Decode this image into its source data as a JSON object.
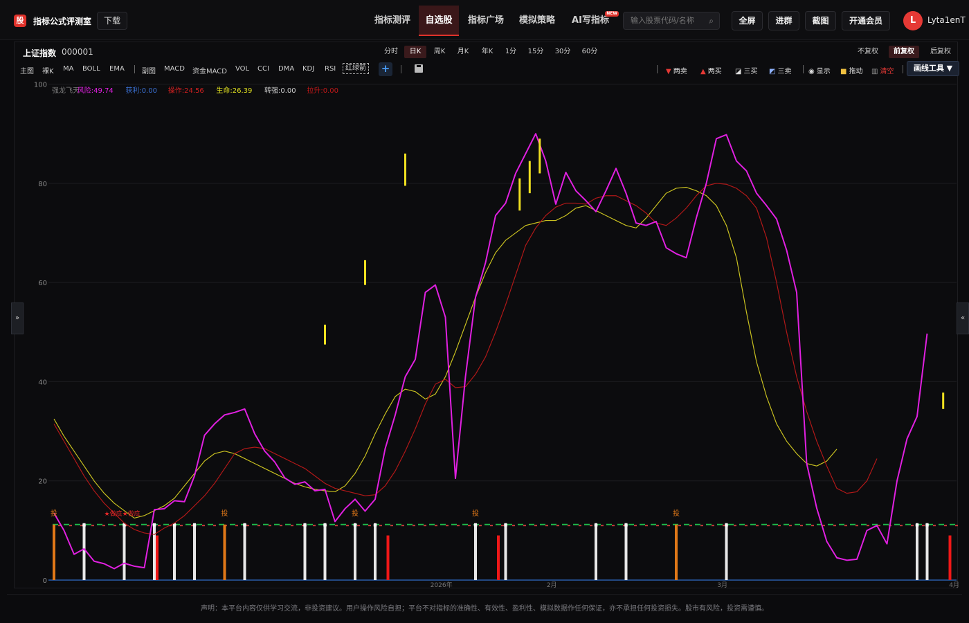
{
  "app": {
    "logo_glyph": "股",
    "title": "指标公式评测室",
    "download_label": "下载"
  },
  "nav": [
    {
      "label": "指标测评",
      "active": false
    },
    {
      "label": "自选股",
      "active": true
    },
    {
      "label": "指标广场",
      "active": false
    },
    {
      "label": "模拟策略",
      "active": false
    },
    {
      "label": "AI写指标",
      "active": false,
      "badge": "NEW"
    }
  ],
  "search": {
    "placeholder": "输入股票代码/名称",
    "icon": "search-icon"
  },
  "top_buttons": [
    "全屏",
    "进群",
    "截图",
    "开通会员"
  ],
  "user": {
    "avatar_letter": "L",
    "name": "Lyta1enT",
    "avatar_color": "#e53935"
  },
  "symbol": {
    "name": "上证指数",
    "code": "000001"
  },
  "periods": [
    "分时",
    "日K",
    "周K",
    "月K",
    "年K",
    "1分",
    "15分",
    "30分",
    "60分"
  ],
  "active_period": "日K",
  "adjust": [
    "不复权",
    "前复权",
    "后复权"
  ],
  "active_adjust": "前复权",
  "indicators": [
    "主图",
    "裸K",
    "MA",
    "BOLL",
    "EMA",
    "副图",
    "MACD",
    "资金MACD",
    "VOL",
    "CCI",
    "DMA",
    "KDJ",
    "RSI",
    "红绿箭"
  ],
  "tools": [
    {
      "label": "两卖",
      "icon": "triangle-down-icon",
      "color": "#e53935"
    },
    {
      "label": "两买",
      "icon": "triangle-up-icon",
      "color": "#e53935"
    },
    {
      "label": "三买",
      "icon": "chart-up-icon",
      "color": "#ddd"
    },
    {
      "label": "三卖",
      "icon": "chart-down-icon",
      "color": "#ddd"
    },
    {
      "label": "显示",
      "icon": "eye-icon",
      "color": "#ddd"
    },
    {
      "label": "拖动",
      "icon": "lock-icon",
      "color": "#f0c040"
    },
    {
      "label": "清空",
      "icon": "trash-icon",
      "color": "#e53935"
    }
  ],
  "draw_tool_label": "画线工具 ▼",
  "side_toggles": {
    "left": "»",
    "right": "«"
  },
  "legend": [
    {
      "label": "强龙飞天",
      "color": "#7a7a7a"
    },
    {
      "label": "风险:49.74",
      "color": "#e020e0"
    },
    {
      "label": "获利:0.00",
      "color": "#3a6fd0"
    },
    {
      "label": "操作:24.56",
      "color": "#d02020"
    },
    {
      "label": "生命:26.39",
      "color": "#e0e020"
    },
    {
      "label": "转强:0.00",
      "color": "#cfcfcf"
    },
    {
      "label": "拉升:0.00",
      "color": "#c01818"
    }
  ],
  "chart_data": {
    "type": "line",
    "ylim": [
      0,
      100
    ],
    "yticks": [
      0,
      20,
      40,
      60,
      80,
      100
    ],
    "xlabels": [
      {
        "label": "2026年",
        "i": 38.6
      },
      {
        "label": "2月",
        "i": 49.6
      },
      {
        "label": "3月",
        "i": 66.6
      },
      {
        "label": "4月",
        "i": 89.7
      }
    ],
    "series": [
      {
        "name": "风险",
        "color": "#e020e0",
        "values": [
          13.5,
          10.0,
          5.2,
          6.3,
          3.8,
          3.3,
          2.3,
          3.4,
          2.8,
          2.5,
          14.2,
          14.4,
          16.0,
          15.8,
          21.0,
          29.2,
          31.5,
          33.3,
          33.8,
          34.5,
          29.5,
          26.0,
          23.8,
          20.6,
          19.3,
          19.8,
          18.0,
          18.3,
          11.8,
          14.4,
          16.3,
          13.9,
          16.3,
          26.5,
          33.3,
          41.0,
          44.5,
          58.0,
          59.5,
          53.0,
          20.5,
          41.0,
          57.0,
          64.0,
          73.5,
          76.0,
          82.0,
          86.0,
          90.0,
          84.5,
          75.8,
          82.2,
          78.5,
          76.5,
          74.3,
          78.5,
          83.0,
          78.0,
          72.0,
          71.5,
          72.3,
          67.0,
          65.8,
          65.0,
          73.0,
          80.0,
          89.0,
          89.8,
          84.5,
          82.5,
          78.0,
          75.5,
          72.8,
          66.5,
          58.0,
          23.5,
          14.5,
          7.8,
          4.5,
          4.0,
          4.2,
          10.0,
          11.0,
          7.3,
          20.0,
          28.5,
          33.0,
          49.7
        ]
      },
      {
        "name": "操作",
        "color": "#b01818",
        "values": [
          31.5,
          28.0,
          24.5,
          21.0,
          18.0,
          15.5,
          13.5,
          11.5,
          10.2,
          9.5,
          9.2,
          10.5,
          11.5,
          13.0,
          15.0,
          17.0,
          19.5,
          22.5,
          25.5,
          26.5,
          26.8,
          26.5,
          25.5,
          24.5,
          23.5,
          22.5,
          21.0,
          19.5,
          18.5,
          18.0,
          17.5,
          17.0,
          17.2,
          19.0,
          22.0,
          26.0,
          30.5,
          35.5,
          39.5,
          40.5,
          38.8,
          39.0,
          41.5,
          45.0,
          50.0,
          55.5,
          61.5,
          67.5,
          71.0,
          73.5,
          75.2,
          76.0,
          76.0,
          75.8,
          77.0,
          77.5,
          77.5,
          76.5,
          75.5,
          74.0,
          72.0,
          71.5,
          73.0,
          75.0,
          77.5,
          79.5,
          80.0,
          79.8,
          79.0,
          77.5,
          75.0,
          69.0,
          60.0,
          50.0,
          41.0,
          34.0,
          28.0,
          23.0,
          18.5,
          17.5,
          17.8,
          20.0,
          24.5
        ]
      },
      {
        "name": "生命",
        "color": "#c8c020",
        "values": [
          32.5,
          29.0,
          26.0,
          23.0,
          20.0,
          17.5,
          15.5,
          14.0,
          12.5,
          13.0,
          14.0,
          15.0,
          16.5,
          19.0,
          21.5,
          24.0,
          25.5,
          26.0,
          25.5,
          24.5,
          23.5,
          22.5,
          21.5,
          20.5,
          19.5,
          18.8,
          18.3,
          18.0,
          17.8,
          19.0,
          21.5,
          25.0,
          29.5,
          33.5,
          37.0,
          38.5,
          38.0,
          36.5,
          37.5,
          41.0,
          46.0,
          51.5,
          57.0,
          62.0,
          66.0,
          68.5,
          70.0,
          71.5,
          72.0,
          72.5,
          72.5,
          73.5,
          75.0,
          75.5,
          74.5,
          73.5,
          72.5,
          71.5,
          71.0,
          73.0,
          75.5,
          78.0,
          79.0,
          79.2,
          78.5,
          77.5,
          75.5,
          71.5,
          65.0,
          54.0,
          44.0,
          37.0,
          31.5,
          28.0,
          25.5,
          23.5,
          23.0,
          24.0,
          26.4
        ]
      }
    ],
    "yellow_bars": [
      {
        "i": 27.0,
        "top": 51.5,
        "bottom": 47.5
      },
      {
        "i": 31.0,
        "top": 64.5,
        "bottom": 59.5
      },
      {
        "i": 35.0,
        "top": 86.0,
        "bottom": 79.5
      },
      {
        "i": 46.4,
        "top": 81.0,
        "bottom": 74.5
      },
      {
        "i": 47.4,
        "top": 84.5,
        "bottom": 78.0
      },
      {
        "i": 48.4,
        "top": 89.0,
        "bottom": 82.0
      },
      {
        "i": 88.6,
        "top": 37.8,
        "bottom": 34.5
      }
    ],
    "dashed_level": 11.2,
    "white_bars_i": [
      3,
      7,
      10,
      12,
      14,
      19,
      25,
      27,
      30,
      32,
      42,
      45,
      54,
      57,
      67,
      86,
      87
    ],
    "orange_bars_i": [
      0,
      17,
      30,
      42,
      62
    ],
    "red_bars_i": [
      10,
      33,
      44,
      89
    ],
    "tou_labels_i": [
      0,
      17,
      30,
      42,
      62
    ],
    "tou_label": "投",
    "annotation": {
      "label": "★做底★做底",
      "i": 5
    }
  },
  "footer_text": "声明：本平台内容仅供学习交流，非投资建议。用户操作风险自担；平台不对指标的准确性、有效性、盈利性、模拟数据作任何保证，亦不承担任何投资损失。股市有风险，投资需谨慎。"
}
